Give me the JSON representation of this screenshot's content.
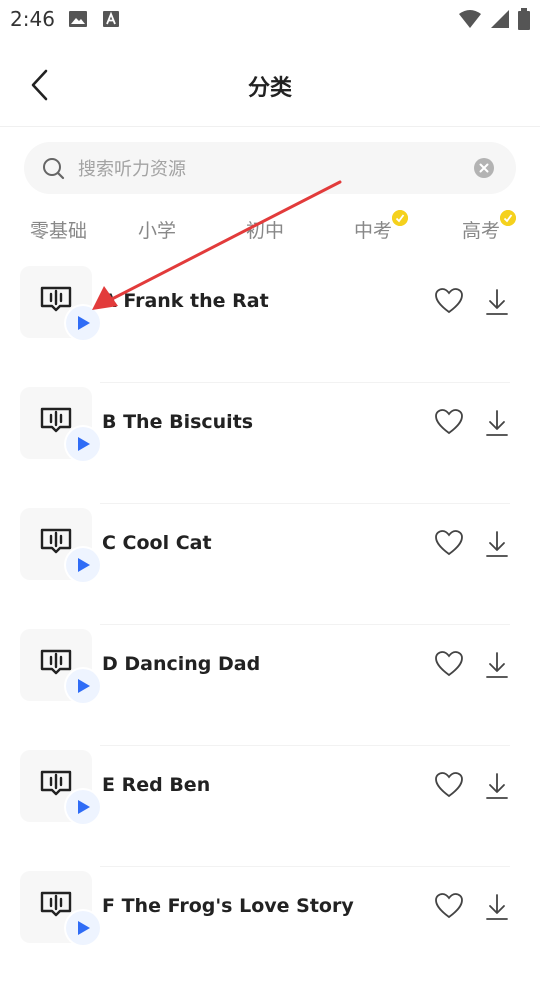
{
  "status_bar": {
    "time": "2:46"
  },
  "header": {
    "title": "分类"
  },
  "search": {
    "placeholder": "搜索听力资源"
  },
  "tabs": [
    {
      "label": "零基础"
    },
    {
      "label": "小学"
    },
    {
      "label": "初中"
    },
    {
      "label": "中考",
      "badge": true
    },
    {
      "label": "高考",
      "badge": true
    }
  ],
  "list": {
    "items": [
      {
        "title": "A Frank the Rat"
      },
      {
        "title": "B The Biscuits"
      },
      {
        "title": "C Cool Cat"
      },
      {
        "title": "D Dancing Dad"
      },
      {
        "title": "E Red Ben"
      },
      {
        "title": "F The Frog's Love Story"
      }
    ]
  },
  "colors": {
    "accent_blue": "#2f6cf6",
    "badge_yellow": "#f5d11d",
    "annotation_red": "#e23b3b"
  }
}
